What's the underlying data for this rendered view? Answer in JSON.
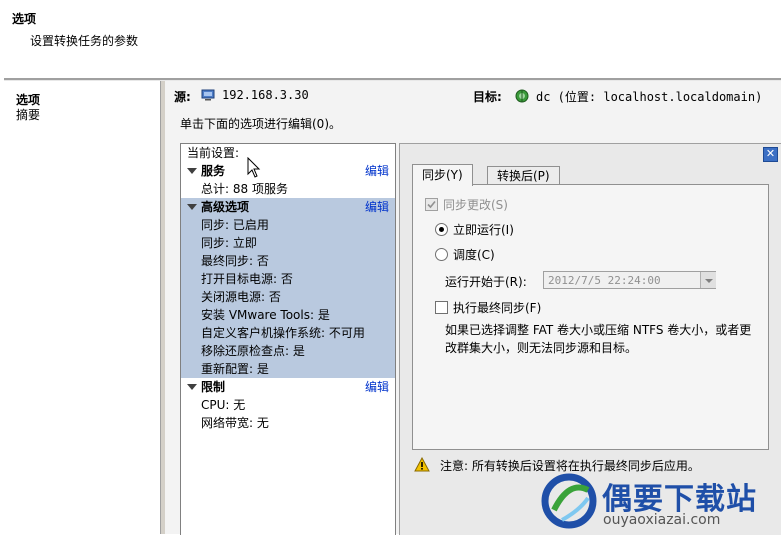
{
  "header": {
    "title": "选项",
    "subtitle": "设置转换任务的参数"
  },
  "nav": {
    "items": [
      {
        "label": "选项",
        "active": true
      },
      {
        "label": "摘要",
        "active": false
      }
    ]
  },
  "source": {
    "label": "源:",
    "value": "192.168.3.30",
    "icon": "server-icon"
  },
  "target": {
    "label": "目标:",
    "value": "dc (位置: localhost.localdomain)",
    "icon": "vcenter-icon"
  },
  "instruction": "单击下面的选项进行编辑(0)。",
  "tree": {
    "current_settings": "当前设置:",
    "edit_label": "编辑",
    "services": {
      "title": "服务",
      "items": [
        "总计: 88 项服务"
      ]
    },
    "advanced": {
      "title": "高级选项",
      "items": [
        "同步: 已启用",
        "同步: 立即",
        "最终同步: 否",
        "打开目标电源: 否",
        "关闭源电源: 否",
        "安装 VMware Tools: 是",
        "自定义客户机操作系统: 不可用",
        "移除还原检查点: 是",
        "重新配置: 是"
      ]
    },
    "limits": {
      "title": "限制",
      "items": [
        "CPU: 无",
        "网络带宽: 无"
      ]
    }
  },
  "tabs": [
    {
      "label": "同步(Y)",
      "active": true
    },
    {
      "label": "转换后(P)",
      "active": false
    }
  ],
  "sync": {
    "sync_changes": "同步更改(S)",
    "run_now": "立即运行(I)",
    "schedule": "调度(C)",
    "start_at_label": "运行开始于(R):",
    "start_at_value": "2012/7/5 22:24:00",
    "final_sync": "执行最终同步(F)",
    "description": "如果已选择调整 FAT 卷大小或压缩 NTFS 卷大小，或者更改群集大小，则无法同步源和目标。"
  },
  "note": "注意: 所有转换后设置将在执行最终同步后应用。",
  "watermark": {
    "name": "偶要下载站",
    "url": "ouyaoxiazai.com"
  },
  "colors": {
    "highlight": "#b9c9df",
    "link": "#0033cc",
    "logo": "#1f4fa8"
  }
}
